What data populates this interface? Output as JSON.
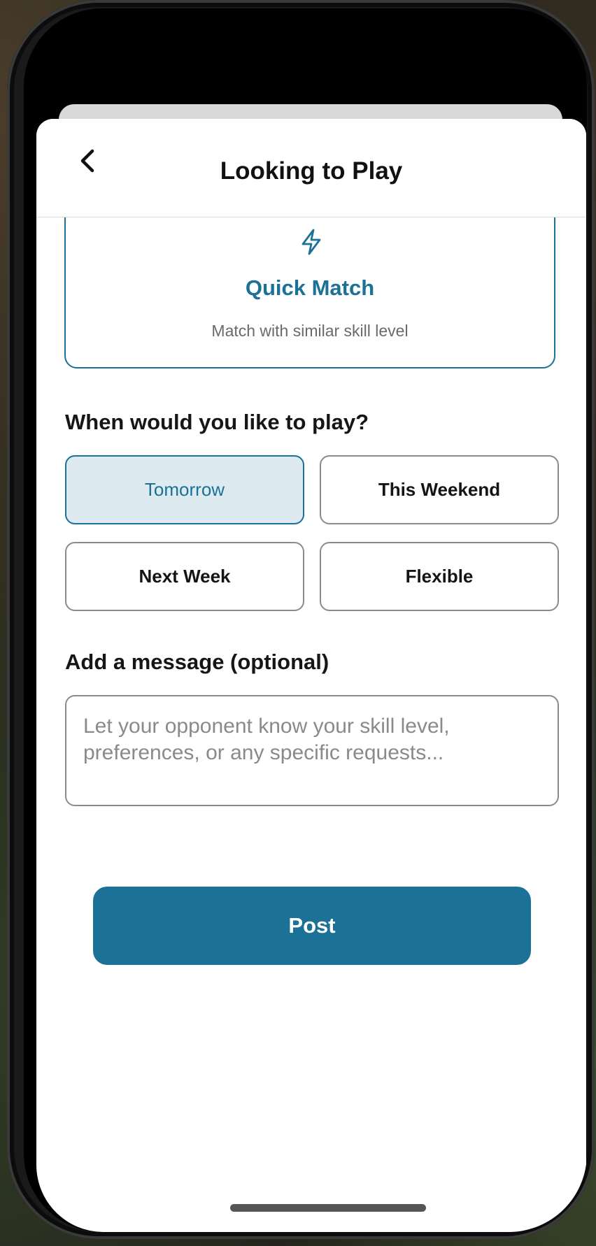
{
  "header": {
    "title": "Looking to Play"
  },
  "quick_match": {
    "title": "Quick Match",
    "subtitle": "Match with similar skill level",
    "icon": "bolt-icon"
  },
  "when": {
    "label": "When would you like to play?",
    "options": [
      {
        "label": "Tomorrow",
        "selected": true
      },
      {
        "label": "This Weekend",
        "selected": false
      },
      {
        "label": "Next Week",
        "selected": false
      },
      {
        "label": "Flexible",
        "selected": false
      }
    ]
  },
  "message": {
    "label": "Add a message (optional)",
    "placeholder": "Let your opponent know your skill level, preferences, or any specific requests...",
    "value": ""
  },
  "post_button": {
    "label": "Post"
  },
  "colors": {
    "accent": "#1b7196",
    "selected_bg": "#ddebf1"
  }
}
